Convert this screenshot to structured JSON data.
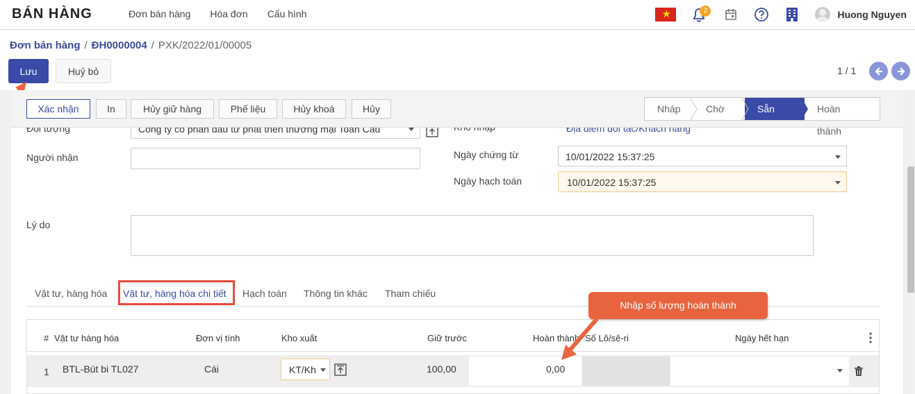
{
  "app": {
    "title": "BÁN HÀNG"
  },
  "nav": {
    "menu": [
      "Đơn bán hàng",
      "Hóa đơn",
      "Cấu hình"
    ],
    "notification_count": "2",
    "username": "Huong Nguyen"
  },
  "breadcrumb": {
    "items": [
      "Đơn bán hàng",
      "ĐH0000004",
      "PXK/2022/01/00005"
    ]
  },
  "actions": {
    "save": "Lưu",
    "discard": "Huỷ bỏ"
  },
  "pager": {
    "value": "1 / 1"
  },
  "statusbar": {
    "buttons": [
      "Xác nhận",
      "In",
      "Hủy giữ hàng",
      "Phế liệu",
      "Hủy khoá",
      "Hủy"
    ],
    "stages": [
      "Nháp",
      "Chờ",
      "Sẵn sàng",
      "Hoàn thành"
    ],
    "active_stage": "Sẵn sàng"
  },
  "form": {
    "partner_label": "Đối tượng",
    "partner_value": "Công ty cổ phần đầu tư phát triển thương mại Toàn Cầu",
    "recipient_label": "Người nhận",
    "recipient_value": "",
    "reason_label": "Lý do",
    "reason_value": "",
    "dest_label": "Kho nhập",
    "dest_value": "Địa điểm đối tác/Khách hàng",
    "doc_date_label": "Ngày chứng từ",
    "doc_date_value": "10/01/2022 15:37:25",
    "acc_date_label": "Ngày hạch toán",
    "acc_date_value": "10/01/2022 15:37:25"
  },
  "tabs": [
    "Vật tư, hàng hóa",
    "Vật tư, hàng hóa chi tiết",
    "Hạch toán",
    "Thông tin khác",
    "Tham chiếu"
  ],
  "table": {
    "headers": [
      "#",
      "Vật tư hàng hóa",
      "Đơn vị tính",
      "Kho xuất",
      "Giữ trước",
      "Hoàn thành",
      "Số Lô/sê-ri",
      "Ngày hết hạn"
    ],
    "rows": [
      {
        "no": "1",
        "product": "BTL-Bút bi TL027",
        "uom": "Cái",
        "warehouse": "KT/Kh",
        "reserved": "100,00",
        "done": "0,00",
        "lot": "",
        "expiry": ""
      }
    ]
  },
  "annotation": {
    "text": "Nhập số lượng hoàn thành"
  },
  "colors": {
    "primary": "#3a4aa6",
    "annotation": "#e8643f",
    "warning_field": "#fff8ec"
  }
}
